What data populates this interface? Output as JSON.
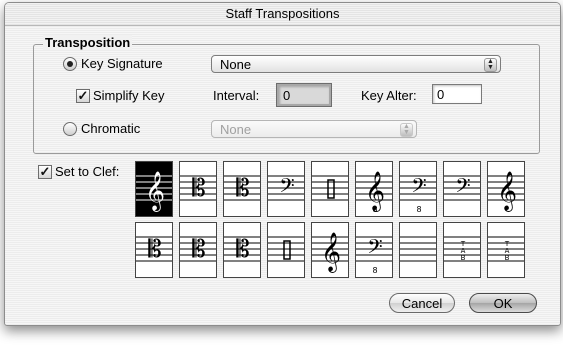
{
  "window": {
    "title": "Staff Transpositions"
  },
  "transposition": {
    "group_label": "Transposition",
    "key_signature": {
      "label": "Key Signature",
      "selected": true,
      "popup_value": "None"
    },
    "simplify_key": {
      "label": "Simplify Key",
      "checked": true
    },
    "interval": {
      "label": "Interval:",
      "value": "0"
    },
    "key_alter": {
      "label": "Key Alter:",
      "value": "0"
    },
    "chromatic": {
      "label": "Chromatic",
      "selected": false,
      "popup_value": "None"
    }
  },
  "set_to_clef": {
    "label": "Set to Clef:",
    "checked": true,
    "selected_index": 0,
    "clefs": [
      {
        "icon": "treble-clef-icon",
        "glyph": "𝄞",
        "annot": ""
      },
      {
        "icon": "alto-clef-icon",
        "glyph": "𝄡",
        "annot": ""
      },
      {
        "icon": "tenor-clef-icon",
        "glyph": "𝄡",
        "annot": ""
      },
      {
        "icon": "bass-clef-icon",
        "glyph": "𝄢",
        "annot": ""
      },
      {
        "icon": "percussion-clef-icon",
        "glyph": "",
        "annot": ""
      },
      {
        "icon": "treble-8vb-clef-icon",
        "glyph": "𝄞",
        "annot": "8"
      },
      {
        "icon": "bass-8vb-clef-icon",
        "glyph": "𝄢",
        "annot": "8"
      },
      {
        "icon": "baritone-clef-icon",
        "glyph": "𝄢",
        "annot": ""
      },
      {
        "icon": "french-violin-clef-icon",
        "glyph": "𝄞",
        "annot": ""
      },
      {
        "icon": "soprano-clef-icon",
        "glyph": "𝄡",
        "annot": ""
      },
      {
        "icon": "mezzo-soprano-clef-icon",
        "glyph": "𝄡",
        "annot": ""
      },
      {
        "icon": "baritone-c-clef-icon",
        "glyph": "𝄡",
        "annot": ""
      },
      {
        "icon": "percussion-2-clef-icon",
        "glyph": "",
        "annot": ""
      },
      {
        "icon": "treble-clef-alt-icon",
        "glyph": "𝄞",
        "annot": ""
      },
      {
        "icon": "bass-8va-clef-icon",
        "glyph": "𝄢",
        "annot": "8"
      },
      {
        "icon": "blank-clef-icon",
        "glyph": "",
        "annot": ""
      },
      {
        "icon": "tab-clef-icon",
        "glyph": "",
        "annot": "TAB"
      },
      {
        "icon": "tab-small-clef-icon",
        "glyph": "",
        "annot": "TAB"
      }
    ]
  },
  "buttons": {
    "cancel": "Cancel",
    "ok": "OK"
  }
}
